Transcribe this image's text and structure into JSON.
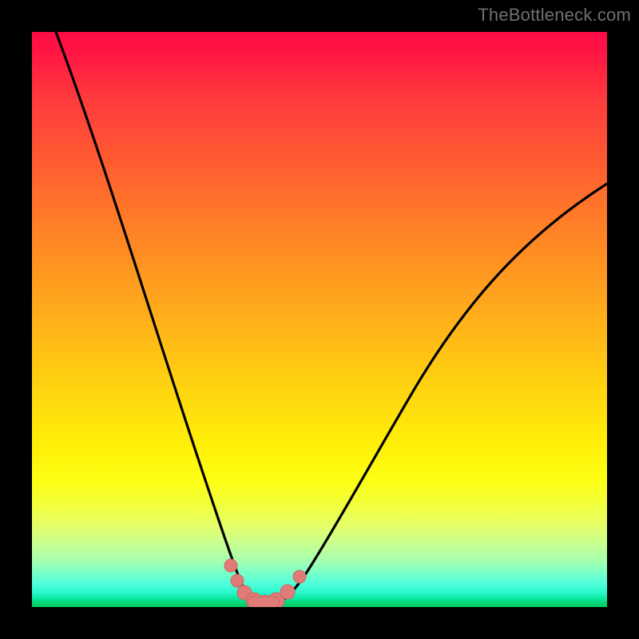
{
  "watermark": {
    "text": "TheBottleneck.com"
  },
  "colors": {
    "frame": "#000000",
    "curve_stroke": "#000000",
    "marker_fill": "#e07b77",
    "marker_stroke": "#cf6662"
  },
  "chart_data": {
    "type": "line",
    "title": "",
    "xlabel": "",
    "ylabel": "",
    "xlim": [
      0,
      100
    ],
    "ylim": [
      0,
      100
    ],
    "grid": false,
    "legend": false,
    "note": "Bottleneck-style V-curve over a vertical red→green gradient. x is normalized capability ratio (0–100); y is bottleneck percentage (0–100). Minimum y≈0 over x≈36–42. Values estimated from pixel positions; no numeric axis labels are printed in the image.",
    "series": [
      {
        "name": "bottleneck-curve",
        "x": [
          0,
          5,
          10,
          15,
          20,
          25,
          28,
          30,
          32,
          34,
          36,
          38,
          40,
          42,
          44,
          46,
          50,
          55,
          60,
          65,
          70,
          75,
          80,
          85,
          90,
          95,
          100
        ],
        "y": [
          100,
          88,
          75,
          61,
          47,
          31,
          22,
          16,
          10,
          5,
          1.5,
          0,
          0,
          1.5,
          4,
          8,
          16,
          25,
          33,
          40,
          46,
          51.5,
          56,
          60,
          63.5,
          66.5,
          69
        ]
      }
    ],
    "annotations": {
      "valley_markers_x": [
        32.5,
        34.5,
        36,
        38,
        40,
        42,
        44,
        46.5
      ],
      "background_gradient_stops": [
        {
          "pos": 0.0,
          "color": "#ff0b46"
        },
        {
          "pos": 0.32,
          "color": "#ff7a28"
        },
        {
          "pos": 0.62,
          "color": "#ffd410"
        },
        {
          "pos": 0.82,
          "color": "#f3ff3a"
        },
        {
          "pos": 1.0,
          "color": "#00c95c"
        }
      ]
    }
  }
}
